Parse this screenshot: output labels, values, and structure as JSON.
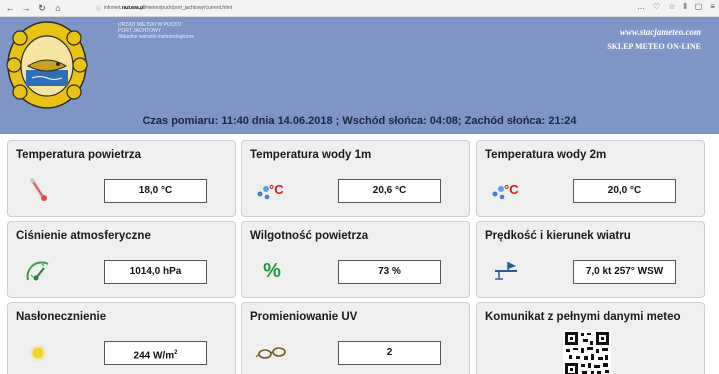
{
  "browser": {
    "nav_icons": [
      "←",
      "→",
      "↻",
      "⌂"
    ],
    "url_prefix": "infomet.",
    "url_domain": "razuwa.pl",
    "url_path": "/meteo/puck/port_jachtowy/current.html",
    "right_icons": [
      "…",
      "♡",
      "☆",
      "⫴",
      "▢",
      "≡"
    ]
  },
  "banner": {
    "org_lines": [
      "URZĄD MIEJSKI W PUCKU",
      "PORT JACHTOWY",
      "Aktualne warunki meteorologiczne"
    ],
    "link1": "www.stacjameteo.com",
    "link2": "SKLEP METEO ON-LINE",
    "measure": "Czas pomiaru: 11:40 dnia 14.06.2018 ; Wschód słońca: 04:08; Zachód słońca: 21:24"
  },
  "tiles": [
    {
      "title": "Temperatura powietrza",
      "value": "18,0 °C",
      "icon": "thermometer-icon"
    },
    {
      "title": "Temperatura wody 1m",
      "value": "20,6 °C",
      "icon": "water-temp-icon",
      "icon_text": "°C"
    },
    {
      "title": "Temperatura wody 2m",
      "value": "20,0 °C",
      "icon": "water-temp-icon",
      "icon_text": "°C"
    },
    {
      "title": "Ciśnienie atmosferyczne",
      "value": "1014,0 hPa",
      "icon": "barometer-icon"
    },
    {
      "title": "Wilgotność powietrza",
      "value": "73 %",
      "icon": "humidity-icon",
      "icon_text": "%"
    },
    {
      "title": "Prędkość i kierunek wiatru",
      "value": "7,0 kt 257° WSW",
      "icon": "anemometer-icon"
    },
    {
      "title": "Nasłonecznienie",
      "value": "244 W/m",
      "value_sup": "2",
      "icon": "sun-icon"
    },
    {
      "title": "Promieniowanie UV",
      "value": "2",
      "icon": "sunglasses-icon"
    },
    {
      "title": "Komunikat z pełnymi danymi meteo",
      "icon": "qr-code-icon"
    }
  ],
  "colors": {
    "banner": "#7e95c6",
    "tile_bg": "#efefef",
    "accent_red": "#d11a1a",
    "accent_green": "#1f9a3a"
  }
}
